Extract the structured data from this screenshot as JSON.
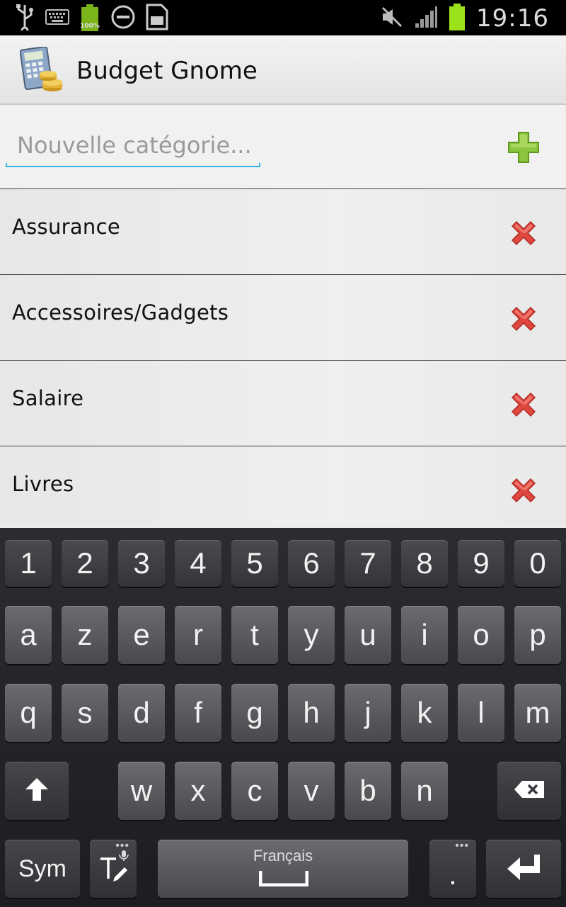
{
  "status_bar": {
    "time": "19:16",
    "battery_label": "100%",
    "icons_left": [
      "usb-icon",
      "keyboard-icon",
      "battery-full-icon",
      "do-not-disturb-icon",
      "sd-card-icon"
    ],
    "icons_right": [
      "mute-icon",
      "signal-icon",
      "battery-icon"
    ]
  },
  "action_bar": {
    "title": "Budget Gnome",
    "icon": "calculator-coins-icon"
  },
  "new_category": {
    "placeholder": "Nouvelle catégorie...",
    "value": "",
    "add_icon": "plus-icon"
  },
  "categories": [
    {
      "label": "Assurance",
      "delete_icon": "delete-x-icon"
    },
    {
      "label": "Accessoires/Gadgets",
      "delete_icon": "delete-x-icon"
    },
    {
      "label": "Salaire",
      "delete_icon": "delete-x-icon"
    },
    {
      "label": "Livres",
      "delete_icon": "delete-x-icon"
    }
  ],
  "keyboard": {
    "row_numbers": [
      "1",
      "2",
      "3",
      "4",
      "5",
      "6",
      "7",
      "8",
      "9",
      "0"
    ],
    "row1": [
      "a",
      "z",
      "e",
      "r",
      "t",
      "y",
      "u",
      "i",
      "o",
      "p"
    ],
    "row2": [
      "q",
      "s",
      "d",
      "f",
      "g",
      "h",
      "j",
      "k",
      "l",
      "m"
    ],
    "row3": [
      "w",
      "x",
      "c",
      "v",
      "b",
      "n"
    ],
    "sym": "Sym",
    "space_label": "Français",
    "period": ".",
    "shift_icon": "shift-arrow-icon",
    "backspace_icon": "backspace-icon",
    "enter_icon": "enter-icon",
    "text_input_icon": "text-edit-mic-icon"
  },
  "colors": {
    "accent": "#33b5e5",
    "add_green": "#8cc63f",
    "delete_red": "#e0473f"
  }
}
